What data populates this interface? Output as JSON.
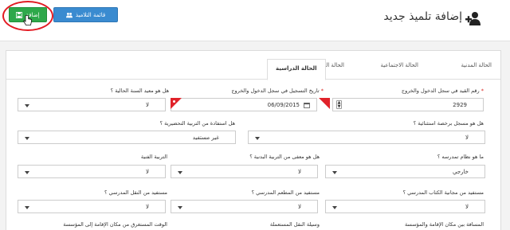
{
  "header": {
    "title": "إضافة تلميذ جديد",
    "user_add_icon": "user-plus-icon",
    "list_button_label": "قائمة التلاميذ",
    "list_button_icon": "group-icon",
    "add_button_label": "إضافة",
    "add_button_icon": "save-icon",
    "colors": {
      "list_button": "#3a8bd0",
      "add_button": "#2ea84a",
      "highlight": "#e31b23"
    }
  },
  "tabs": [
    {
      "label": "الحالة المدنية",
      "active": false
    },
    {
      "label": "الحالة الاجتماعية",
      "active": false
    },
    {
      "label": "الحالة الصحية",
      "active": false
    },
    {
      "label": "الحالة الدراسية",
      "active": true
    }
  ],
  "fields": {
    "registry_number": {
      "label": "رقم القيد في سجل الدخول والخروج",
      "required_mark": "*",
      "value": "2929"
    },
    "registration_date": {
      "label": "تاريخ التسجيل في سجل الدخول والخروج",
      "required_mark": "*",
      "value": "06/09/2015"
    },
    "repeating_year": {
      "label": "هل هو معيد السنة الحالية ؟",
      "value": "لا"
    },
    "special_exception": {
      "label": "هل هو مسجل برخصة استثنائية ؟",
      "value": "لا"
    },
    "preparatory": {
      "label": "هل استفادة من التربية التحضيرية ؟",
      "value": "غير مستفيد"
    },
    "study_system": {
      "label": "ما هو نظام تمدرسه ؟",
      "value": "خارجي"
    },
    "pe_exempt": {
      "label": "هل هو معفى من التربية البدنية ؟",
      "value": "لا"
    },
    "arts_education": {
      "label": "التربية الفنية",
      "value": "لا"
    },
    "school_book": {
      "label": "مستفيد من مجانية الكتاب المدرسي ؟",
      "value": "لا"
    },
    "school_canteen": {
      "label": "مستفيد من المطعم المدرسي ؟",
      "value": "لا"
    },
    "school_transport": {
      "label": "مستفيد من النقل المدرسي ؟",
      "value": "لا"
    },
    "distance": {
      "label": "المسافة بين مكان الإقامة والمؤسسة"
    },
    "transport_means": {
      "label": "وسيلة النقل المستعملة"
    },
    "travel_time": {
      "label": "الوقت المستغرق من مكان الإقامة إلى المؤسسة"
    }
  }
}
